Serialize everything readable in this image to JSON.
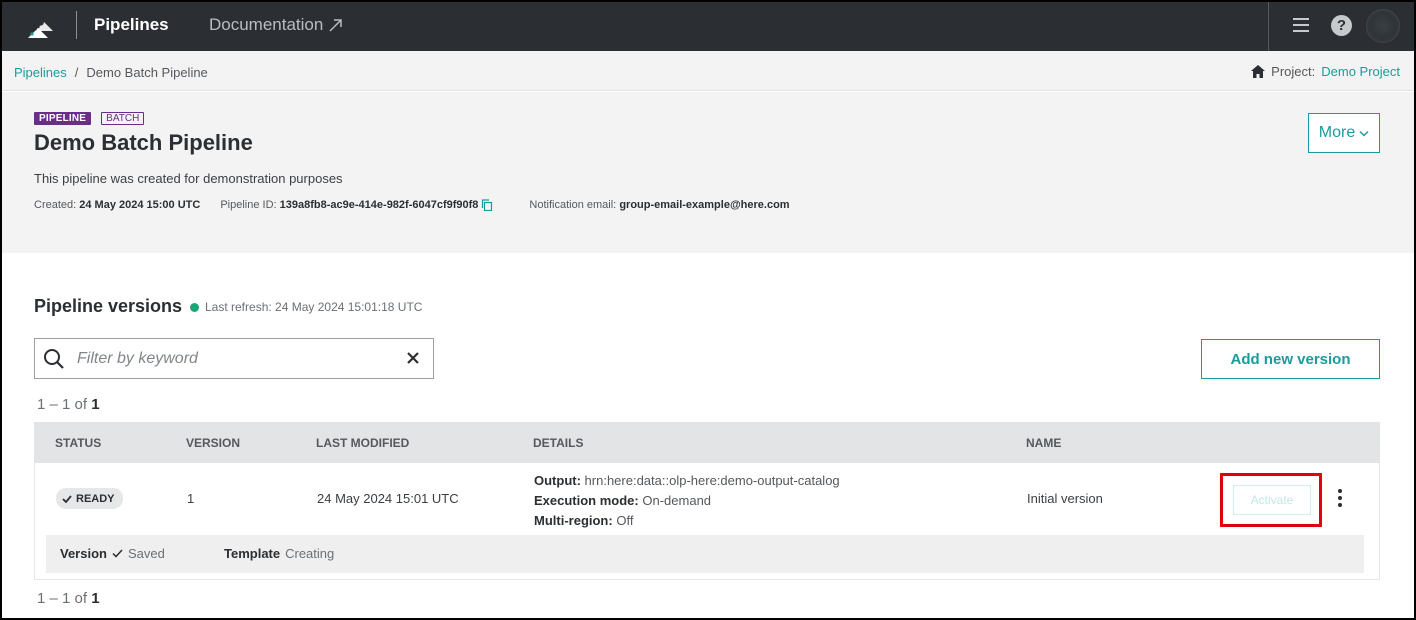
{
  "nav": {
    "app_name": "Pipelines",
    "documentation": "Documentation"
  },
  "breadcrumb": {
    "root": "Pipelines",
    "separator": "/",
    "current": "Demo Batch Pipeline"
  },
  "project": {
    "label": "Project:",
    "name": "Demo Project"
  },
  "pipeline": {
    "tag_primary": "PIPELINE",
    "tag_secondary": "BATCH",
    "title": "Demo Batch Pipeline",
    "description": "This pipeline was created for demonstration purposes",
    "created_label": "Created:",
    "created_value": "24 May 2024 15:00 UTC",
    "id_label": "Pipeline ID:",
    "id_value": "139a8fb8-ac9e-414e-982f-6047cf9f90f8",
    "email_label": "Notification email:",
    "email_value": "group-email-example@here.com",
    "more_label": "More"
  },
  "versions": {
    "title": "Pipeline versions",
    "refresh": "Last refresh: 24 May 2024 15:01:18 UTC",
    "search_placeholder": "Filter by keyword",
    "add_label": "Add new version",
    "count_prefix": "1 – 1 of",
    "count_total": "1",
    "columns": {
      "status": "STATUS",
      "version": "VERSION",
      "last_modified": "LAST MODIFIED",
      "details": "DETAILS",
      "name": "NAME"
    },
    "rows": [
      {
        "status": "READY",
        "version": "1",
        "last_modified": "24 May 2024 15:01 UTC",
        "output_label": "Output:",
        "output_value": "hrn:here:data::olp-here:demo-output-catalog",
        "exec_label": "Execution mode:",
        "exec_value": "On-demand",
        "region_label": "Multi-region:",
        "region_value": "Off",
        "name": "Initial version",
        "activate_label": "Activate",
        "sub_version_label": "Version",
        "sub_version_value": "Saved",
        "sub_template_label": "Template",
        "sub_template_value": "Creating"
      }
    ]
  },
  "colors": {
    "accent": "#1a9c9c",
    "topbar": "#2b2f33",
    "tag": "#6b2d8a",
    "highlight": "#e0000f",
    "status_dot": "#18a678"
  }
}
